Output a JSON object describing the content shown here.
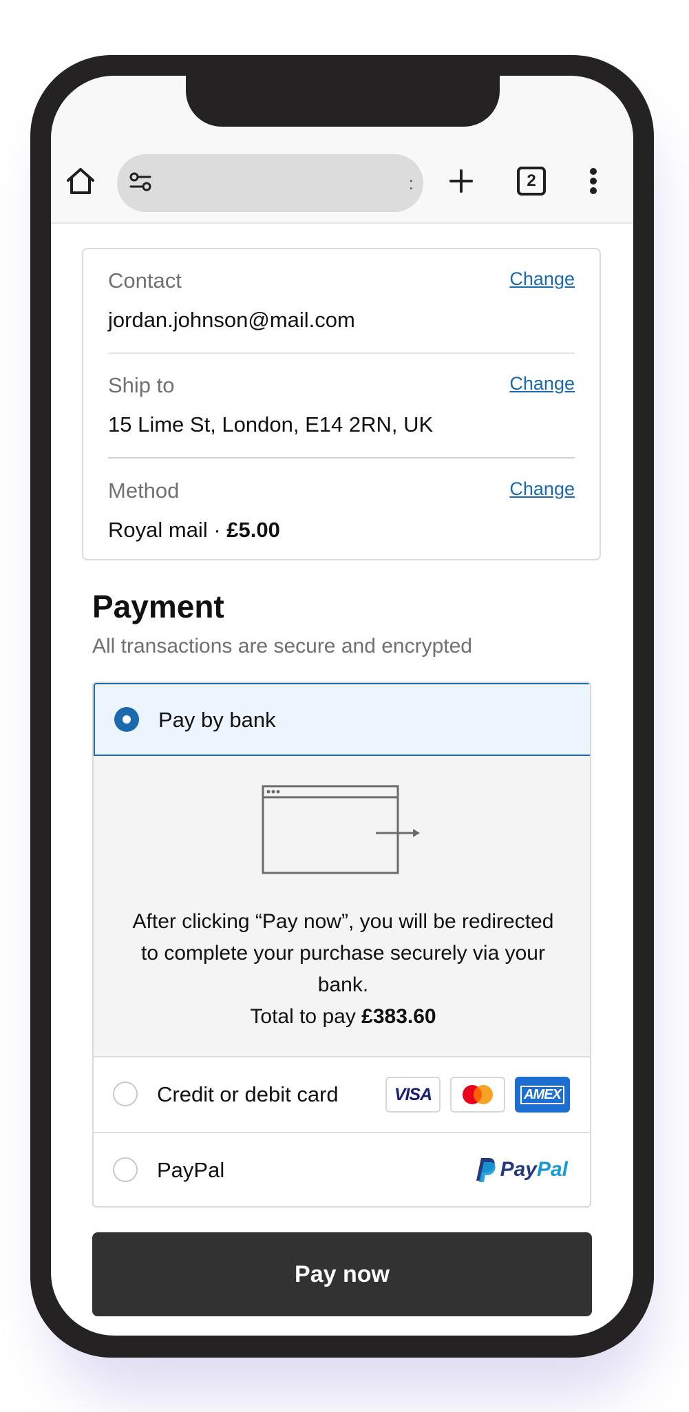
{
  "browser": {
    "url_text": ":",
    "tab_count": "2"
  },
  "summary": {
    "contact_label": "Contact",
    "contact_value": "jordan.johnson@mail.com",
    "ship_label": "Ship to",
    "ship_value": "15 Lime St, London, E14 2RN, UK",
    "method_label": "Method",
    "method_value": "Royal mail · ",
    "method_price": "£5.00",
    "change_label": "Change"
  },
  "payment": {
    "title": "Payment",
    "subtitle": "All transactions are secure and encrypted",
    "selected_method": "Pay by bank",
    "options": [
      {
        "label": "Pay by bank",
        "selected": true
      },
      {
        "label": "Credit or debit card",
        "selected": false
      },
      {
        "label": "PayPal",
        "selected": false
      }
    ],
    "bank_text_1": "After clicking “Pay now”, you will be redirected to complete your purchase securely via your bank.",
    "bank_total_label": "Total to pay ",
    "bank_total_value": "£383.60",
    "card_logos": [
      "VISA",
      "mastercard",
      "AMEX"
    ],
    "paypal_logo_pay": "Pay",
    "paypal_logo_pal": "Pal"
  },
  "actions": {
    "pay_now": "Pay now"
  },
  "colors": {
    "accent": "#1c6aae",
    "selected_bg": "#ecf4fe",
    "button_bg": "#323232",
    "phone_frame": "#252223"
  },
  "icons": [
    "home-icon",
    "site-settings-icon",
    "new-tab-plus-icon",
    "tab-switcher-icon",
    "more-menu-icon",
    "browser-redirect-icon"
  ]
}
